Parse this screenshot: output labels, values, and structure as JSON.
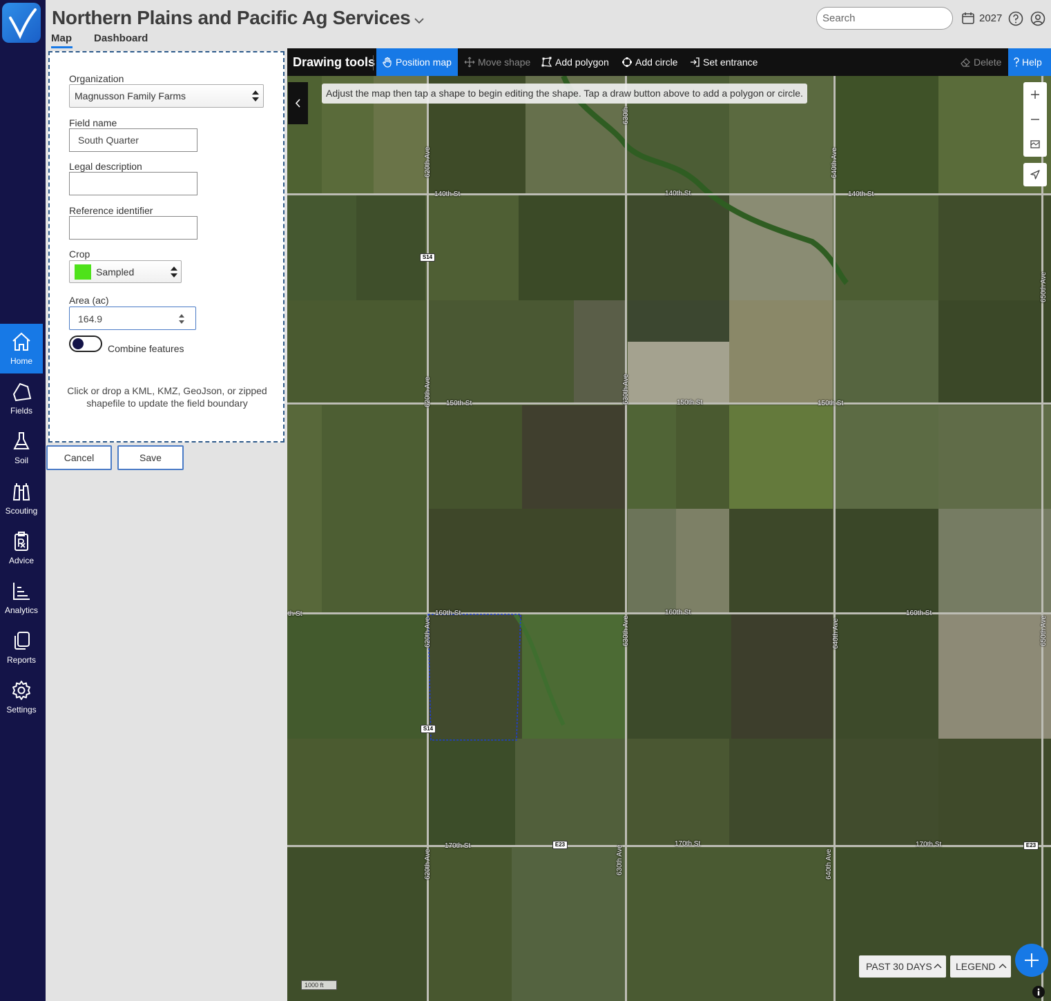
{
  "app": {
    "org_title": "Northern Plains and Pacific Ag Services",
    "tabs": [
      {
        "label": "Map",
        "active": true
      },
      {
        "label": "Dashboard",
        "active": false
      }
    ],
    "search_placeholder": "Search",
    "year": "2027"
  },
  "sidebar": {
    "items": [
      {
        "label": "Home",
        "icon": "home-icon",
        "active": true
      },
      {
        "label": "Fields",
        "icon": "fields-icon"
      },
      {
        "label": "Soil",
        "icon": "flask-icon"
      },
      {
        "label": "Scouting",
        "icon": "binoculars-icon"
      },
      {
        "label": "Advice",
        "icon": "prescription-icon"
      },
      {
        "label": "Analytics",
        "icon": "bar-chart-icon"
      },
      {
        "label": "Reports",
        "icon": "copy-icon"
      },
      {
        "label": "Settings",
        "icon": "gear-icon"
      }
    ]
  },
  "form": {
    "organization_label": "Organization",
    "organization_value": "Magnusson Family Farms",
    "field_name_label": "Field name",
    "field_name_value": "South Quarter",
    "legal_description_label": "Legal description",
    "legal_description_value": "",
    "reference_identifier_label": "Reference identifier",
    "reference_identifier_value": "",
    "crop_label": "Crop",
    "crop_value": "Sampled",
    "crop_color": "#4ee21a",
    "area_label": "Area (ac)",
    "area_value": "164.9",
    "combine_label": "Combine features",
    "drop_hint": "Click or drop a KML, KMZ, GeoJson, or zipped shapefile to update the field boundary",
    "cancel_label": "Cancel",
    "save_label": "Save"
  },
  "toolbar": {
    "title": "Drawing tools",
    "position_map": "Position map",
    "move_shape": "Move shape",
    "add_polygon": "Add polygon",
    "add_circle": "Add circle",
    "set_entrance": "Set entrance",
    "delete": "Delete",
    "help": "Help"
  },
  "map": {
    "hint": "Adjust the map then tap a shape to begin editing the shape. Tap a draw button above to add a polygon or circle.",
    "roads": {
      "st140": "140th St",
      "st150": "150th St",
      "st160": "160th St",
      "st160_partial": "th St",
      "st170": "170th St",
      "ave620": "620th Ave",
      "ave630": "630th Ave",
      "ave640": "640th Ave",
      "ave650": "650th Ave",
      "ave630_partial": "630th"
    },
    "shields": {
      "s14": "S14",
      "e23": "E23"
    },
    "past_30_days": "PAST 30 DAYS",
    "legend": "LEGEND",
    "scale": "1000 ft"
  }
}
